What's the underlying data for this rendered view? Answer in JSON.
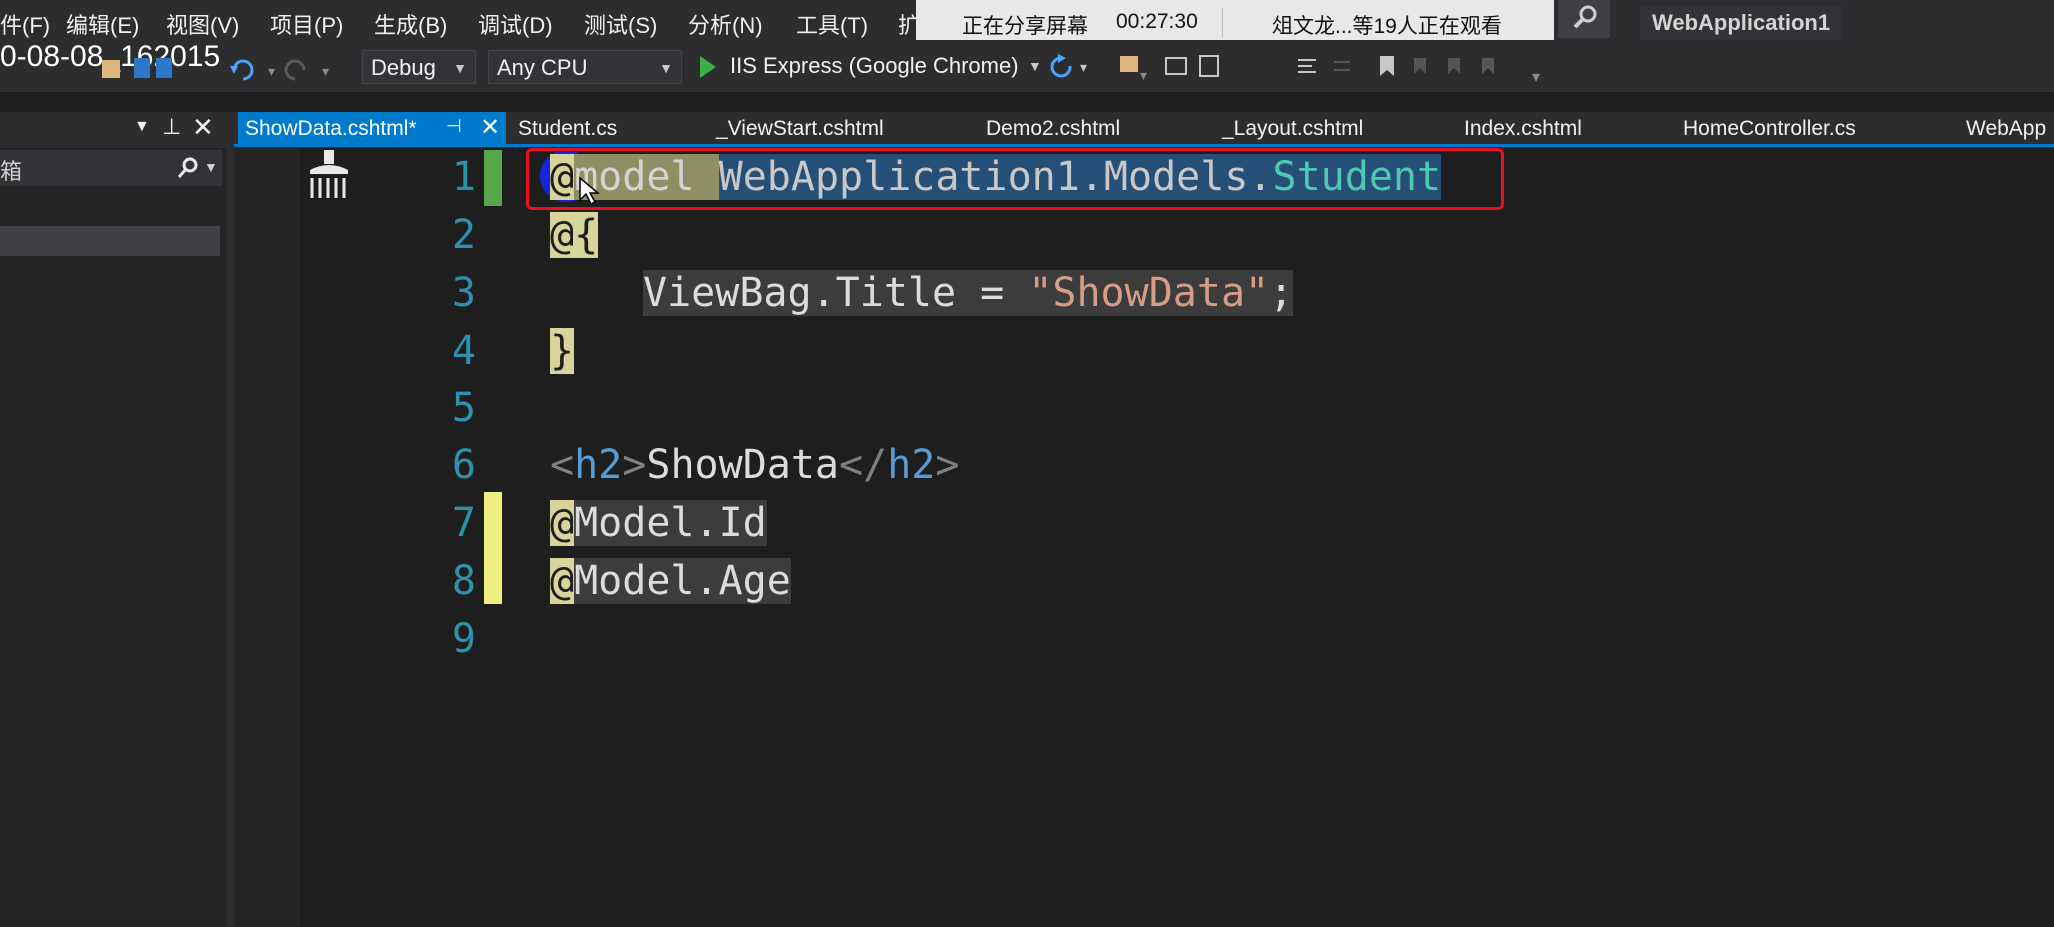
{
  "menu": {
    "items": [
      "件(F)",
      "编辑(E)",
      "视图(V)",
      "项目(P)",
      "生成(B)",
      "调试(D)",
      "测试(S)",
      "分析(N)",
      "工具(T)",
      "扩"
    ]
  },
  "share_bar": {
    "sharing_label": "正在分享屏幕",
    "elapsed": "00:27:30",
    "viewers": "俎文龙...等19人正在观看"
  },
  "app_title": "WebApplication1",
  "overlay_timestamp": "0-08-08_162015",
  "toolbar": {
    "config": "Debug",
    "platform": "Any CPU",
    "run_target": "IIS Express (Google Chrome)"
  },
  "left_panel": {
    "search_label": "箱"
  },
  "tabs": [
    {
      "label": "ShowData.cshtml*",
      "active": true
    },
    {
      "label": "Student.cs"
    },
    {
      "label": "_ViewStart.cshtml"
    },
    {
      "label": "Demo2.cshtml"
    },
    {
      "label": "_Layout.cshtml"
    },
    {
      "label": "Index.cshtml"
    },
    {
      "label": "HomeController.cs"
    },
    {
      "label": "WebApp"
    }
  ],
  "code": {
    "line_numbers": [
      "1",
      "2",
      "3",
      "4",
      "5",
      "6",
      "7",
      "8",
      "9"
    ],
    "l1": {
      "at": "@",
      "kw": "model",
      "ns": "WebApplication1.Models.",
      "type": "Student"
    },
    "l2": {
      "at": "@",
      "brace": "{"
    },
    "l3": {
      "obj": "ViewBag.Title = ",
      "str": "\"ShowData\"",
      "end": ";"
    },
    "l4": {
      "brace": "}"
    },
    "l6": {
      "open": "<",
      "tag": "h2",
      "close": ">",
      "text": "ShowData",
      "open2": "</",
      "tag2": "h2",
      "close2": ">"
    },
    "l7": {
      "at": "@",
      "expr": "Model.Id"
    },
    "l8": {
      "at": "@",
      "expr": "Model.Age"
    }
  },
  "colors": {
    "accent": "#007acc",
    "highlight_box": "#e81123",
    "line_number": "#2b91af",
    "string": "#d69d85",
    "type": "#4ec9b0"
  }
}
